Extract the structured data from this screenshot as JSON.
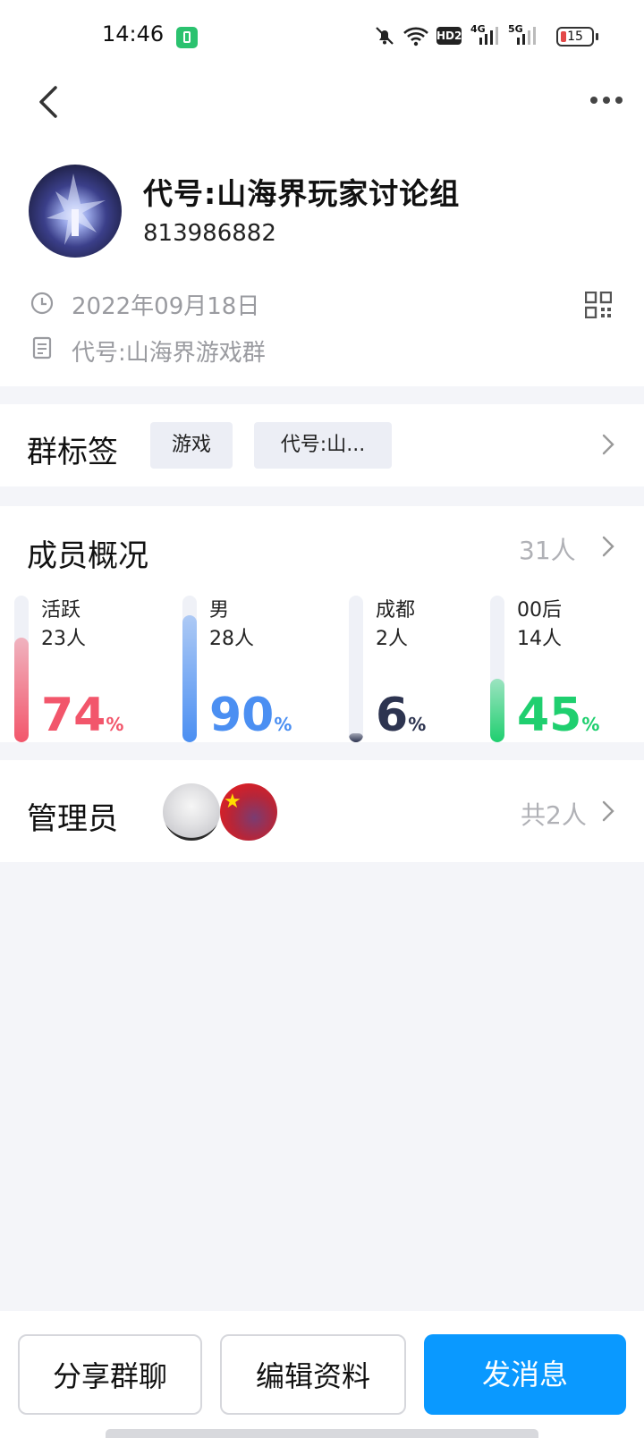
{
  "status_bar": {
    "time": "14:46",
    "battery": "15",
    "network_badges": [
      "HD2",
      "4G",
      "5G"
    ],
    "icons": [
      "charging-icon",
      "mute-bell-icon",
      "wifi-icon",
      "hd-icon",
      "signal-4g-icon",
      "signal-5g-icon",
      "battery-icon"
    ]
  },
  "header": {
    "back_icon": "chevron-left-icon",
    "more_icon": "more-dots-icon"
  },
  "group": {
    "name": "代号:山海界玩家讨论组",
    "id": "813986882",
    "created_date": "2022年09月18日",
    "description": "代号:山海界游戏群",
    "qr_icon": "qr-code-icon"
  },
  "tags": {
    "title": "群标签",
    "items": [
      "游戏",
      "代号:山..."
    ]
  },
  "members": {
    "title": "成员概况",
    "count": "31人",
    "stats": [
      {
        "label": "活跃",
        "count": "23人",
        "percent": "74",
        "sign": "%",
        "fill": 0.74,
        "color": "#f2566b"
      },
      {
        "label": "男",
        "count": "28人",
        "percent": "90",
        "sign": "%",
        "fill": 0.9,
        "color": "#4b8ff2"
      },
      {
        "label": "成都",
        "count": "2人",
        "percent": "6",
        "sign": "%",
        "fill": 0.06,
        "color": "#2d3450"
      },
      {
        "label": "00后",
        "count": "14人",
        "percent": "45",
        "sign": "%",
        "fill": 0.45,
        "color": "#1fcf6f"
      }
    ]
  },
  "admins": {
    "title": "管理员",
    "count": "共2人"
  },
  "actions": {
    "share": "分享群聊",
    "edit": "编辑资料",
    "send": "发消息"
  }
}
